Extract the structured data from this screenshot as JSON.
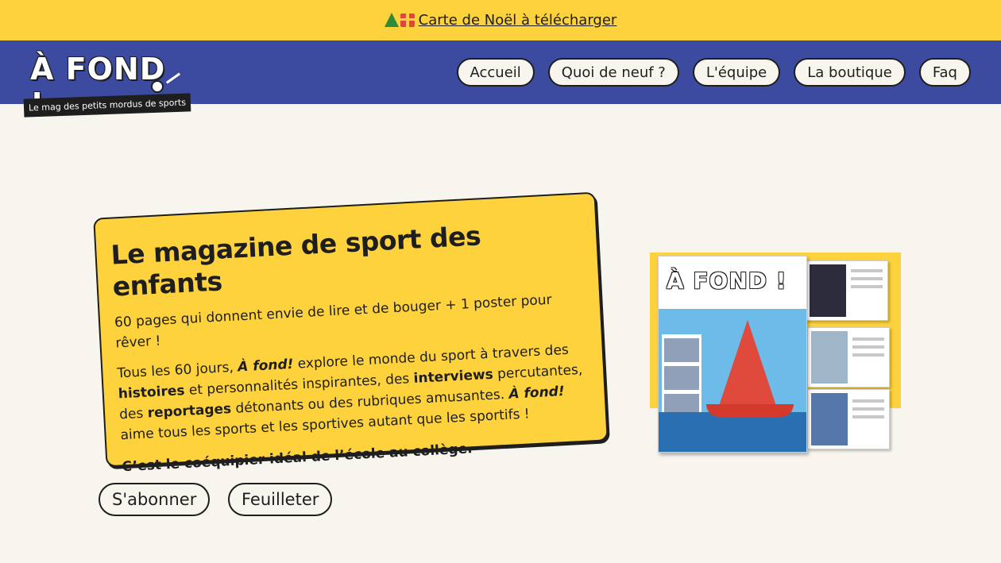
{
  "announcement": {
    "icons": [
      "christmas-tree-icon",
      "gift-icon"
    ],
    "link_text": "Carte de Noël à télécharger"
  },
  "brand": {
    "logo_text": "À FOND !",
    "tagline": "Le mag des petits mordus de sports"
  },
  "nav": {
    "items": [
      {
        "label": "Accueil"
      },
      {
        "label": "Quoi de neuf ?"
      },
      {
        "label": "L'équipe"
      },
      {
        "label": "La boutique"
      },
      {
        "label": "Faq"
      }
    ]
  },
  "hero": {
    "title": "Le magazine de sport des enfants",
    "intro": "60 pages qui donnent envie de lire et de bouger + 1 poster pour rêver !",
    "body": {
      "t1": "Tous les 60 jours, ",
      "mag1": "À fond!",
      "t2": " explore le monde du sport à travers des ",
      "kw1": "histoires",
      "t3": " et personnalités inspirantes, des ",
      "kw2": "interviews",
      "t4": " percutantes, des ",
      "kw3": "reportages",
      "t5": " détonants ou des rubriques amusantes. ",
      "mag2": "À fond!",
      "t6": " aime tous les sports et les sportives autant que les sportifs !"
    },
    "closing": "C’est le coéquipier idéal de l’école au collège."
  },
  "cta": {
    "subscribe": "S'abonner",
    "browse": "Feuilleter"
  },
  "magazine": {
    "cover_title": "À FOND !"
  },
  "colors": {
    "yellow": "#fdd23c",
    "navy": "#3c4b9f",
    "background": "#f7f5ee",
    "ink": "#1e1e1e"
  }
}
